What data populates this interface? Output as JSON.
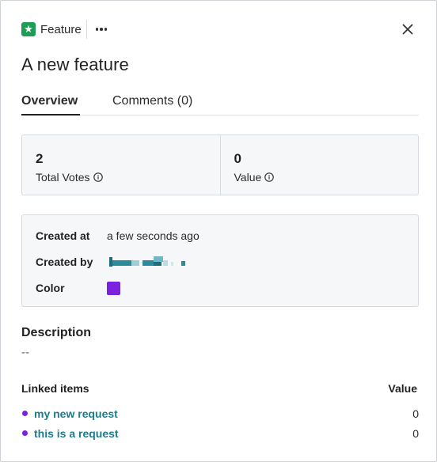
{
  "header": {
    "type_label": "Feature",
    "type_icon": "star-icon",
    "more_icon": "more-horizontal-icon",
    "close_icon": "close-icon"
  },
  "title": "A new feature",
  "tabs": [
    {
      "label": "Overview",
      "active": true
    },
    {
      "label": "Comments (0)",
      "active": false
    }
  ],
  "stats": [
    {
      "value": "2",
      "label": "Total Votes"
    },
    {
      "value": "0",
      "label": "Value"
    }
  ],
  "details": {
    "created_at": {
      "label": "Created at",
      "value": "a few seconds ago"
    },
    "created_by": {
      "label": "Created by"
    },
    "color": {
      "label": "Color",
      "value": "#7a22e0"
    }
  },
  "description": {
    "heading": "Description",
    "value": "--"
  },
  "linked": {
    "heading": "Linked items",
    "value_heading": "Value",
    "items": [
      {
        "label": "my new request",
        "value": "0"
      },
      {
        "label": "this is a request",
        "value": "0"
      }
    ]
  },
  "colors": {
    "accent_green": "#1f9d55",
    "link": "#1b7c8e",
    "purple": "#7a22e0"
  }
}
